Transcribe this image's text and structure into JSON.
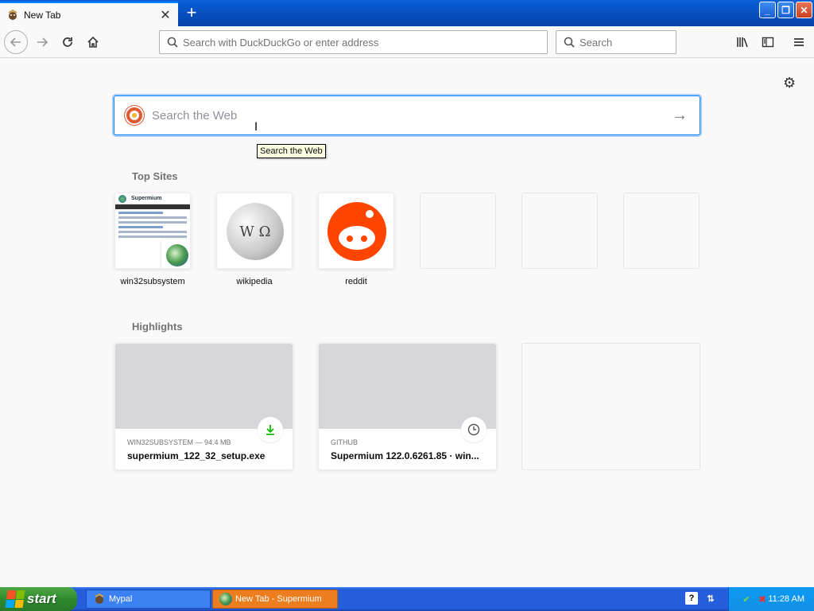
{
  "browser": {
    "tab_title": "New Tab",
    "new_tab_icon": "plus-icon",
    "window_controls": [
      "minimize",
      "restore",
      "close"
    ]
  },
  "navbar": {
    "urlbar_placeholder": "Search with DuckDuckGo or enter address",
    "searchbar_placeholder": "Search"
  },
  "content": {
    "web_search_placeholder": "Search the Web",
    "tooltip": "Search the Web",
    "top_sites_title": "Top Sites",
    "top_sites": [
      {
        "label": "win32subsystem"
      },
      {
        "label": "wikipedia"
      },
      {
        "label": "reddit"
      },
      {
        "label": ""
      },
      {
        "label": ""
      },
      {
        "label": ""
      }
    ],
    "highlights_title": "Highlights",
    "highlights": [
      {
        "meta": "WIN32SUBSYSTEM — 94.4 MB",
        "title": "supermium_122_32_setup.exe",
        "badge": "download-icon"
      },
      {
        "meta": "GITHUB",
        "title": "Supermium 122.0.6261.85 · win...",
        "badge": "clock-icon"
      }
    ],
    "thumbnail_text": "Supermium"
  },
  "taskbar": {
    "start_label": "start",
    "tasks": [
      {
        "label": "Mypal"
      },
      {
        "label": "New Tab - Supermium"
      }
    ],
    "clock": "11:28 AM"
  },
  "colors": {
    "accent": "#0a84ff",
    "reddit": "#ff4500",
    "taskbar": "#245edb",
    "start": "#2f8a2d",
    "active_task": "#ec7e1f"
  }
}
